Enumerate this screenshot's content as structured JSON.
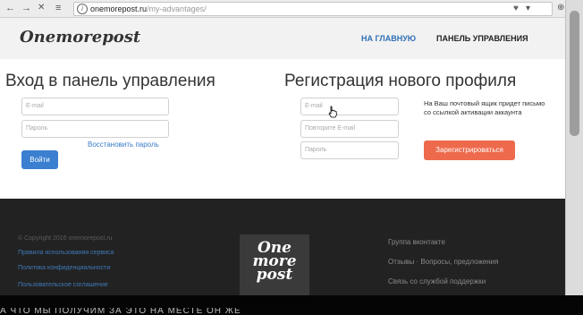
{
  "browser": {
    "url_host": "onemorepost.ru",
    "url_path": "/my-advantages/",
    "back": "←",
    "forward": "→",
    "close": "✕",
    "reader": "≡"
  },
  "header": {
    "logo": "Onemorepost",
    "nav": {
      "home": "НА ГЛАВНУЮ",
      "dashboard": "ПАНЕЛЬ УПРАВЛЕНИЯ"
    },
    "colors": {
      "home": "#2f6fb5",
      "dashboard": "#222222"
    }
  },
  "login": {
    "title": "Вход в панель управления",
    "email_placeholder": "E-mail",
    "password_placeholder": "Пароль",
    "restore": "Восстановить пароль",
    "submit": "Войти"
  },
  "register": {
    "title": "Регистрация нового профиля",
    "email_placeholder": "E-mail",
    "repeat_placeholder": "Повторите E-mail",
    "password_placeholder": "Пароль",
    "hint": "На Ваш почтовый ящик придет письмо со ссылкой активации аккаунта",
    "submit": "Зарегистрироваться"
  },
  "footer": {
    "copyright": "© Copyright 2016 onemorepost.ru",
    "links": [
      "Правила использования сервиса",
      "Политика конфиденциальности",
      "Пользовательское соглашение"
    ],
    "right_links": [
      "Группа вконтакте",
      "Отзывы · Вопросы, предложения",
      "Связь со службой поддержки"
    ],
    "badge": [
      "One",
      "more",
      "post"
    ]
  },
  "colors": {
    "login_button": "#3a7fd0",
    "register_button": "#ee6a4c"
  },
  "subtitle": "А ЧТО МЫ ПОЛУЧИМ ЗА ЭТО НА МЕСТЕ ОН ЖЕ"
}
